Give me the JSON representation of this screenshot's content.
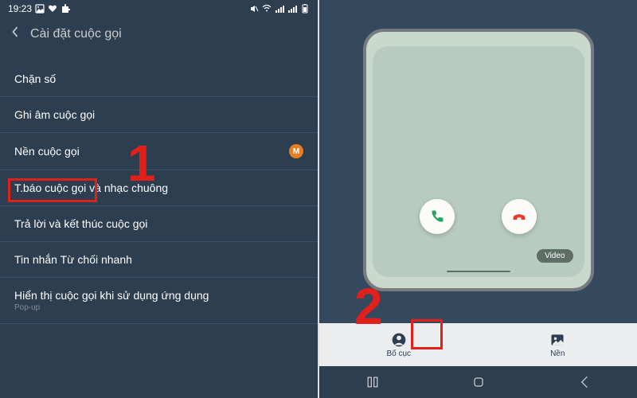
{
  "status": {
    "time": "19:23"
  },
  "header": {
    "title": "Cài đặt cuộc gọi"
  },
  "list": {
    "items": [
      {
        "label": "Chặn số",
        "sub": ""
      },
      {
        "label": "Ghi âm cuộc gọi",
        "sub": ""
      },
      {
        "label": "Nền cuộc gọi",
        "sub": "",
        "badge": "M"
      },
      {
        "label": "T.báo cuộc gọi và nhạc chuông",
        "sub": ""
      },
      {
        "label": "Trả lời và kết thúc cuộc gọi",
        "sub": ""
      },
      {
        "label": "Tin nhắn Từ chối nhanh",
        "sub": ""
      },
      {
        "label": "Hiển thị cuộc gọi khi sử dụng ứng dụng",
        "sub": "Pop-up"
      }
    ]
  },
  "phone": {
    "video_label": "Video"
  },
  "tabs": {
    "layout": "Bố cục",
    "background": "Nền"
  },
  "steps": {
    "one": "1",
    "two": "2"
  }
}
